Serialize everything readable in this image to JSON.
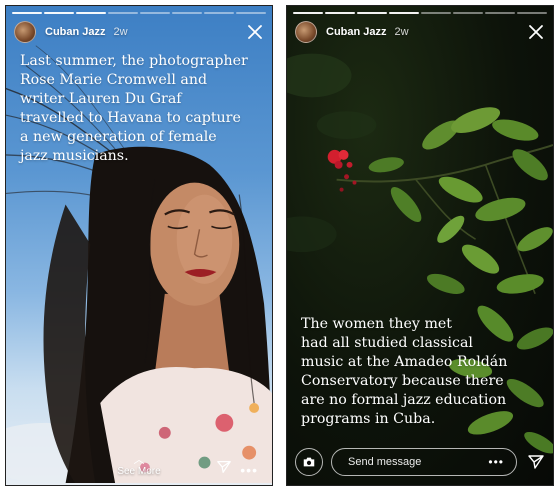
{
  "stories": [
    {
      "account": "Cuban Jazz",
      "age": "2w",
      "caption": "Last summer, the photographer\nRose Marie Cromwell and\nwriter Lauren Du Graf\ntravelled to Havana to capture\na new generation of female\njazz musicians.",
      "footer": {
        "see_more_label": "See More",
        "more_label": "•••"
      }
    },
    {
      "account": "Cuban Jazz",
      "age": "2w",
      "caption": "The women they met\nhad all studied classical\nmusic at the Amadeo Roldán\nConservatory because there\nare no formal jazz education\nprograms in Cuba.",
      "footer": {
        "message_placeholder": "Send message",
        "more_label": "•••"
      }
    }
  ],
  "icons": {
    "close": "close-icon",
    "share": "paper-plane-icon",
    "camera": "camera-icon",
    "see_more": "chevron-up-icon"
  }
}
